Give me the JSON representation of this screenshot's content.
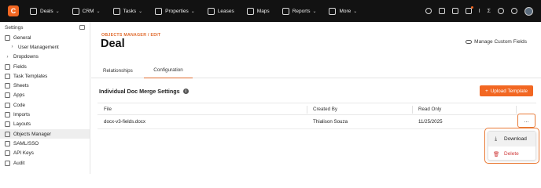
{
  "topnav": {
    "logo_letter": "C",
    "items": [
      {
        "label": "Deals",
        "icon": "deals-icon",
        "has_menu": true
      },
      {
        "label": "CRM",
        "icon": "crm-icon",
        "has_menu": true
      },
      {
        "label": "Tasks",
        "icon": "tasks-icon",
        "has_menu": true
      },
      {
        "label": "Properties",
        "icon": "properties-icon",
        "has_menu": true
      },
      {
        "label": "Leases",
        "icon": "leases-icon",
        "has_menu": false
      },
      {
        "label": "Maps",
        "icon": "maps-icon",
        "has_menu": false
      },
      {
        "label": "Reports",
        "icon": "reports-icon",
        "has_menu": true
      },
      {
        "label": "More",
        "icon": "more-icon",
        "has_menu": true
      }
    ],
    "chevron": "⌄",
    "right_icons": [
      "search-icon",
      "folder-icon",
      "calendar-icon",
      "notifications-icon",
      "text-tool-icon",
      "sigma-icon",
      "help-icon",
      "settings-icon",
      "avatar"
    ]
  },
  "sidebar": {
    "title": "Settings",
    "items": [
      {
        "label": "General",
        "icon": "gear-icon"
      },
      {
        "label": "User Management",
        "icon": "chevron-right-icon",
        "sub": true
      },
      {
        "label": "Dropdowns",
        "icon": "chevron-right-icon"
      },
      {
        "label": "Fields",
        "icon": "fields-icon"
      },
      {
        "label": "Task Templates",
        "icon": "task-templates-icon"
      },
      {
        "label": "Sheets",
        "icon": "sheets-icon"
      },
      {
        "label": "Apps",
        "icon": "apps-icon"
      },
      {
        "label": "Code",
        "icon": "code-icon"
      },
      {
        "label": "Imports",
        "icon": "imports-icon"
      },
      {
        "label": "Layouts",
        "icon": "layouts-icon"
      },
      {
        "label": "Objects Manager",
        "icon": "objects-manager-icon",
        "active": true
      },
      {
        "label": "SAML/SSO",
        "icon": "saml-icon"
      },
      {
        "label": "API Keys",
        "icon": "api-keys-icon"
      },
      {
        "label": "Audit",
        "icon": "audit-icon"
      }
    ]
  },
  "main": {
    "breadcrumb": "OBJECTS MANAGER / EDIT",
    "title": "Deal",
    "manage_link": "Manage Custom Fields",
    "tabs": [
      {
        "label": "Relationships",
        "active": false
      },
      {
        "label": "Configuration",
        "active": true
      }
    ],
    "section_title": "Individual Doc Merge Settings",
    "info_glyph": "i",
    "upload_plus": "+",
    "upload_label": "Upload Template",
    "table": {
      "headers": [
        "File",
        "Created By",
        "Read Only"
      ],
      "rows": [
        {
          "file": "docx-v3-fields.docx",
          "created_by": "Thialison Souza",
          "read_only": "11/25/2025"
        }
      ]
    },
    "more_label": "...",
    "menu": {
      "download": "Download",
      "download_icon": "⤓",
      "delete": "Delete",
      "delete_icon": "🗑"
    }
  },
  "colors": {
    "accent": "#f26722",
    "nav_bg": "#121212",
    "delete_red": "#d03b3b"
  }
}
